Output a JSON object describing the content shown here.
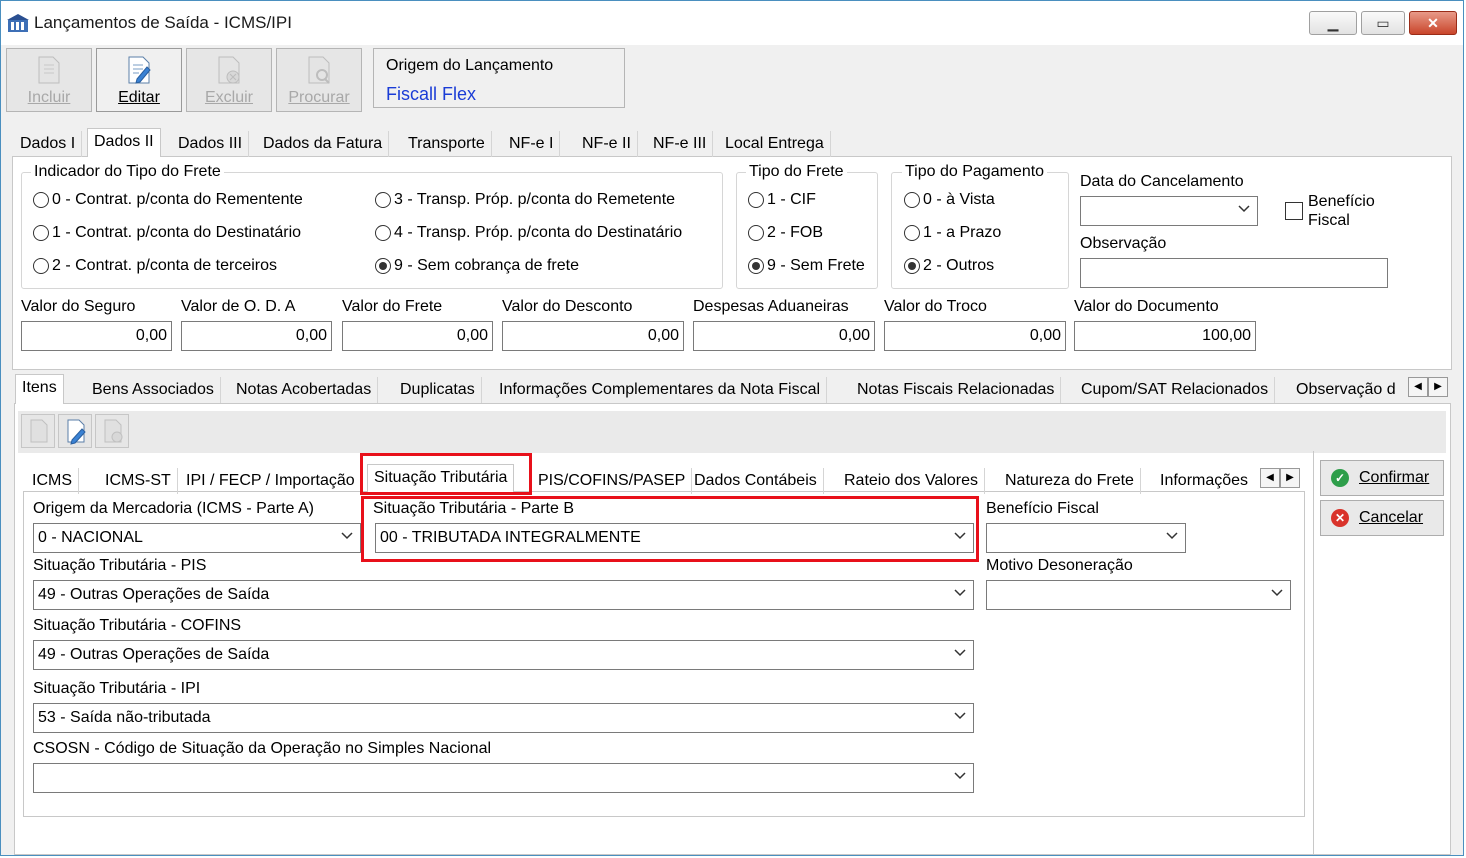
{
  "window": {
    "title": "Lançamentos de Saída - ICMS/IPI"
  },
  "toolbar": {
    "incluir": "Incluir",
    "editar": "Editar",
    "excluir": "Excluir",
    "procurar": "Procurar",
    "origem_label": "Origem do Lançamento",
    "origem_value": "Fiscall Flex"
  },
  "top_tabs": [
    "Dados I",
    "Dados II",
    "Dados III",
    "Dados da Fatura",
    "Transporte",
    "NF-e I",
    "NF-e II",
    "NF-e III",
    "Local Entrega"
  ],
  "frete_indicador": {
    "title": "Indicador do Tipo do Frete",
    "options": [
      "0 - Contrat. p/conta do Rementente",
      "1 - Contrat. p/conta do Destinatário",
      "2 - Contrat. p/conta de terceiros",
      "3 - Transp. Próp. p/conta do Remetente",
      "4 - Transp. Próp. p/conta do Destinatário",
      "9 - Sem cobrança de frete"
    ],
    "selected": "9 - Sem cobrança de frete"
  },
  "tipo_frete": {
    "title": "Tipo do Frete",
    "options": [
      "1 - CIF",
      "2 - FOB",
      "9 - Sem Frete"
    ],
    "selected": "9 - Sem Frete"
  },
  "tipo_pagamento": {
    "title": "Tipo do Pagamento",
    "options": [
      "0 - à Vista",
      "1 - a Prazo",
      "2 - Outros"
    ],
    "selected": "2 - Outros"
  },
  "data_cancelamento": {
    "label": "Data do Cancelamento",
    "value": ""
  },
  "beneficio_fiscal_check": {
    "label1": "Benefício",
    "label2": "Fiscal",
    "checked": false
  },
  "observacao": {
    "label": "Observação",
    "value": ""
  },
  "values": [
    {
      "label": "Valor do Seguro",
      "value": "0,00"
    },
    {
      "label": "Valor de O. D. A",
      "value": "0,00"
    },
    {
      "label": "Valor do Frete",
      "value": "0,00"
    },
    {
      "label": "Valor do Desconto",
      "value": "0,00"
    },
    {
      "label": "Despesas Aduaneiras",
      "value": "0,00"
    },
    {
      "label": "Valor do Troco",
      "value": "0,00"
    },
    {
      "label": "Valor do Documento",
      "value": "100,00"
    }
  ],
  "mid_tabs": [
    "Itens",
    "Bens Associados",
    "Notas Acobertadas",
    "Duplicatas",
    "Informações Complementares da Nota Fiscal",
    "Notas Fiscais Relacionadas",
    "Cupom/SAT Relacionados",
    "Observação d"
  ],
  "item_tabs": [
    "ICMS",
    "ICMS-ST",
    "IPI / FECP / Importação",
    "Situação Tributária",
    "PIS/COFINS/PASEP",
    "Dados Contábeis",
    "Rateio dos Valores",
    "Natureza do Frete",
    "Informações"
  ],
  "fields": {
    "origem": {
      "label": "Origem da Mercadoria (ICMS - Parte A)",
      "value": "0 - NACIONAL"
    },
    "sit_b": {
      "label": "Situação Tributária - Parte B",
      "value": "00 - TRIBUTADA INTEGRALMENTE"
    },
    "beneficio": {
      "label": "Benefício Fiscal",
      "value": ""
    },
    "pis": {
      "label": "Situação Tributária - PIS",
      "value": "49 - Outras Operações de Saída"
    },
    "motivo": {
      "label": "Motivo Desoneração",
      "value": ""
    },
    "cofins": {
      "label": "Situação Tributária - COFINS",
      "value": "49 - Outras Operações de Saída"
    },
    "ipi": {
      "label": "Situação Tributária - IPI",
      "value": "53 - Saída não-tributada"
    },
    "csosn": {
      "label": "CSOSN - Código de Situação da Operação no Simples Nacional",
      "value": ""
    }
  },
  "actions": {
    "confirmar": "Confirmar",
    "cancelar": "Cancelar"
  },
  "colors": {
    "highlight": "#e8101a",
    "link_blue": "#1a3cd6",
    "confirm_green": "#2e9e4a",
    "cancel_red": "#d9332b"
  }
}
